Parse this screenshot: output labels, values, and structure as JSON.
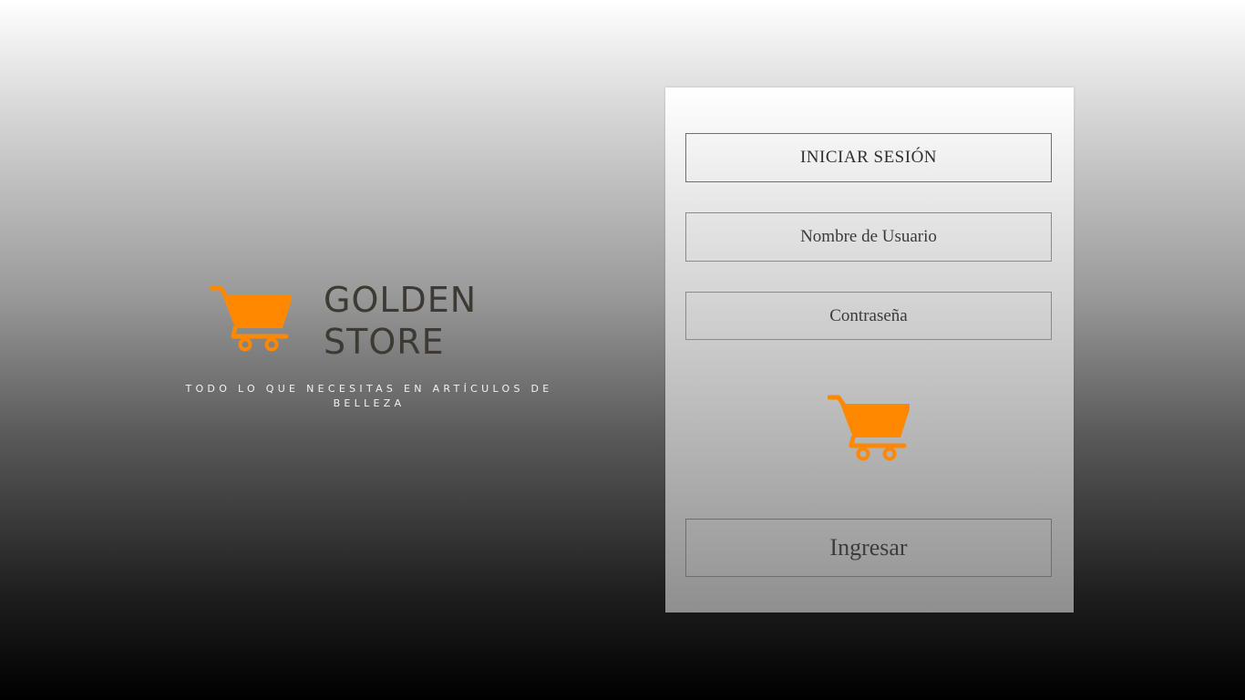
{
  "brand": {
    "name_line1": "GOLDEN",
    "name_line2": "STORE",
    "tagline": "TODO LO QUE NECESITAS EN ARTÍCULOS DE BELLEZA",
    "logo_icon": "shopping-cart-icon"
  },
  "login_panel": {
    "title": "INICIAR SESIÓN",
    "username_placeholder": "Nombre de Usuario",
    "password_placeholder": "Contraseña",
    "center_icon": "shopping-cart-icon",
    "submit_label": "Ingresar"
  },
  "colors": {
    "accent": "#FF8800",
    "brand_text": "#3C3A33",
    "tagline_text": "#F2F2F2"
  }
}
